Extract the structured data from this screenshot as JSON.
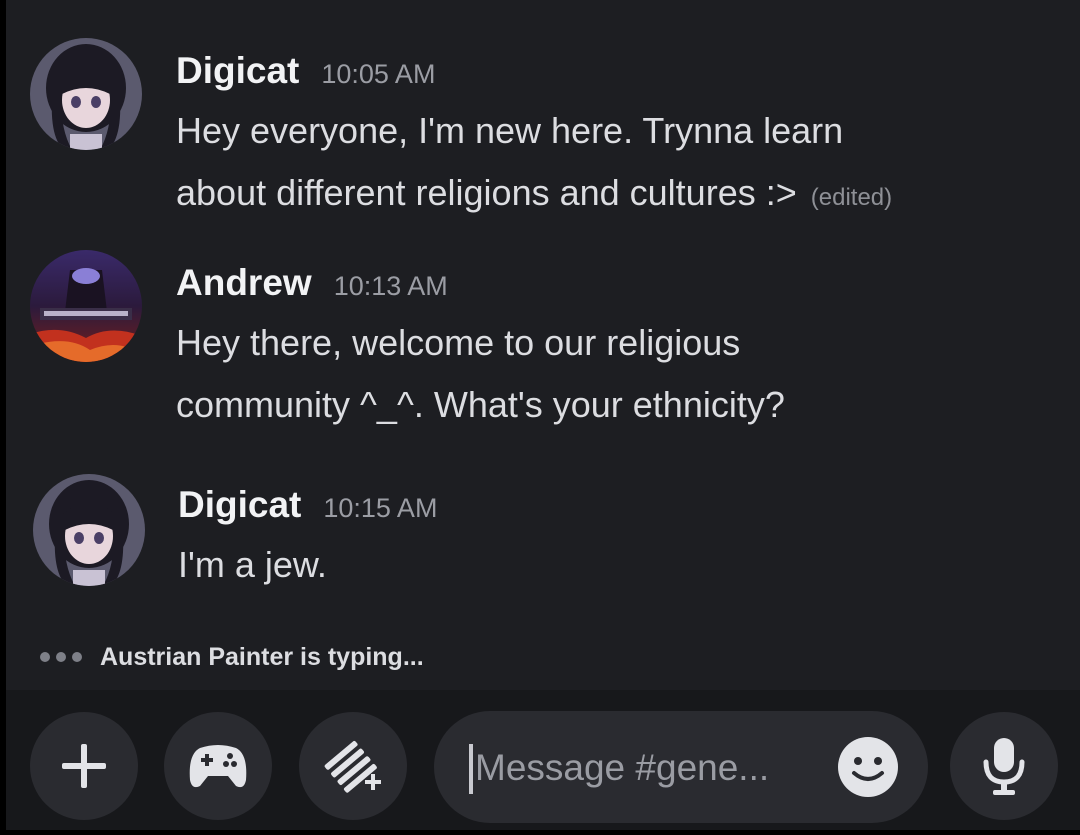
{
  "messages": [
    {
      "author": "Digicat",
      "time": "10:05 AM",
      "lines": [
        "Hey everyone, I'm new here. Trynna learn",
        "about different religions and cultures :>"
      ],
      "edited_label": "(edited)"
    },
    {
      "author": "Andrew",
      "time": "10:13 AM",
      "lines": [
        "Hey there, welcome to our religious",
        "community ^_^. What's your ethnicity?"
      ]
    },
    {
      "author": "Digicat",
      "time": "10:15 AM",
      "lines": [
        "I'm a jew."
      ]
    }
  ],
  "typing_indicator": "Austrian Painter is typing...",
  "composer": {
    "placeholder": "Message #gene...",
    "buttons": [
      "plus-icon",
      "gamepad-icon",
      "apps-icon",
      "emoji-icon",
      "microphone-icon"
    ]
  },
  "colors": {
    "background": "#1d1e22",
    "bottom_bar": "#17181b",
    "button": "#2a2b30",
    "username": "#f2f3f5",
    "text": "#dcdde1",
    "muted": "#9b9da4"
  }
}
